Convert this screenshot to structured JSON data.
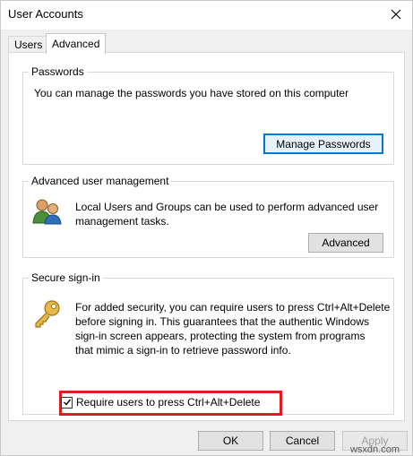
{
  "window": {
    "title": "User Accounts",
    "tabs": [
      {
        "label": "Users",
        "selected": false
      },
      {
        "label": "Advanced",
        "selected": true
      }
    ]
  },
  "passwords": {
    "group_label": "Passwords",
    "text": "You can manage the passwords you have stored on this computer",
    "button_label": "Manage Passwords"
  },
  "advanced_user_management": {
    "group_label": "Advanced user management",
    "text_line1": "Local Users and Groups can be used to perform advanced user",
    "text_line2": "management tasks.",
    "button_label": "Advanced",
    "icon": "users-group-icon"
  },
  "secure_signin": {
    "group_label": "Secure sign-in",
    "text_lines": [
      "For added security, you can require users to press Ctrl+Alt+Delete",
      "before signing in. This guarantees that the authentic Windows",
      "sign-in screen appears, protecting the system from programs",
      "that mimic a sign-in to retrieve password info."
    ],
    "icon": "key-icon",
    "checkbox_label": "Require users to press Ctrl+Alt+Delete",
    "checkbox_checked": true
  },
  "footer": {
    "ok_label": "OK",
    "cancel_label": "Cancel",
    "apply_label": "Apply",
    "apply_enabled": false
  },
  "watermark": "wsxdn.com",
  "colors": {
    "highlight": "#e01b22",
    "focus": "#0078d7",
    "panel": "#f0f0f0"
  }
}
